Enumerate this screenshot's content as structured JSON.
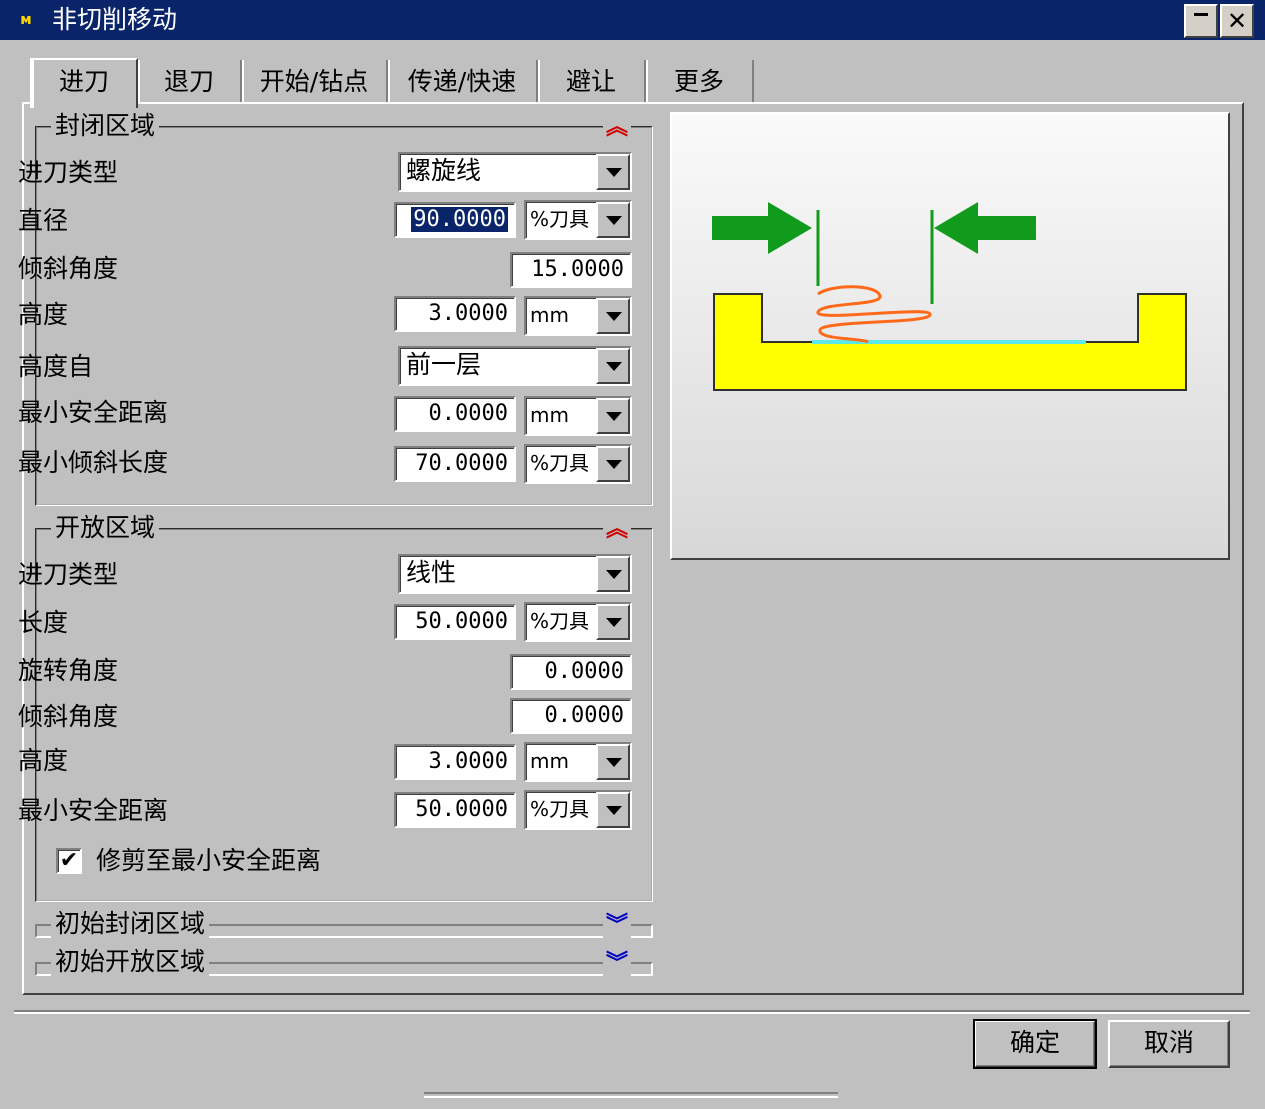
{
  "window": {
    "title": "非切削移动",
    "icon": "app-icon",
    "title_icon_text": "м"
  },
  "titlebar": {
    "close_label": "✕"
  },
  "tabs": [
    {
      "label": "进刀",
      "active": true
    },
    {
      "label": "退刀"
    },
    {
      "label": "开始/钻点"
    },
    {
      "label": "传递/快速"
    },
    {
      "label": "避让"
    },
    {
      "label": "更多"
    }
  ],
  "closed_area": {
    "title": "封闭区域",
    "collapse_icon": "⌃",
    "entry_type_label": "进刀类型",
    "entry_type_value": "螺旋线",
    "diameter_label": "直径",
    "diameter_value": "90.0000",
    "diameter_unit": "%刀具",
    "ramp_angle_label": "倾斜角度",
    "ramp_angle_value": "15.0000",
    "height_label": "高度",
    "height_value": "3.0000",
    "height_unit": "mm",
    "height_from_label": "高度自",
    "height_from_value": "前一层",
    "min_clearance_label": "最小安全距离",
    "min_clearance_value": "0.0000",
    "min_clearance_unit": "mm",
    "min_ramp_length_label": "最小倾斜长度",
    "min_ramp_length_value": "70.0000",
    "min_ramp_length_unit": "%刀具"
  },
  "open_area": {
    "title": "开放区域",
    "entry_type_label": "进刀类型",
    "entry_type_value": "线性",
    "length_label": "长度",
    "length_value": "50.0000",
    "length_unit": "%刀具",
    "rotation_angle_label": "旋转角度",
    "rotation_angle_value": "0.0000",
    "ramp_angle_label": "倾斜角度",
    "ramp_angle_value": "0.0000",
    "height_label": "高度",
    "height_value": "3.0000",
    "height_unit": "mm",
    "min_clearance_label": "最小安全距离",
    "min_clearance_value": "50.0000",
    "min_clearance_unit": "%刀具",
    "trim_label": "修剪至最小安全距离",
    "trim_checked": true,
    "check_mark": "✔"
  },
  "initial_closed_area": {
    "title": "初始封闭区域"
  },
  "initial_open_area": {
    "title": "初始开放区域"
  },
  "colors": {
    "arrow": "#119b1c",
    "part": "#ffff00",
    "helix": "#ff6a1a",
    "floor": "#5ce8e8"
  },
  "buttons": {
    "ok": "确定",
    "cancel": "取消"
  }
}
